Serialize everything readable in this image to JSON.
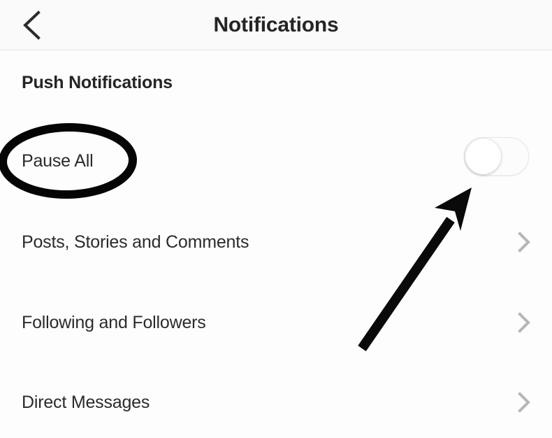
{
  "header": {
    "title": "Notifications",
    "back_icon": "chevron-left-icon"
  },
  "section": {
    "title": "Push Notifications"
  },
  "rows": [
    {
      "label": "Pause All",
      "control": "toggle",
      "toggle_state": "off"
    },
    {
      "label": "Posts, Stories and Comments",
      "control": "chevron-right-icon"
    },
    {
      "label": "Following and Followers",
      "control": "chevron-right-icon"
    },
    {
      "label": "Direct Messages",
      "control": "chevron-right-icon"
    }
  ],
  "annotations": {
    "ellipse": {
      "target": "Pause All",
      "color": "#050505"
    },
    "arrow": {
      "target": "Pause All toggle",
      "color": "#0a0a0a"
    }
  },
  "colors": {
    "background": "#fdfdfd",
    "header_background": "#fafafa",
    "text_primary": "#252525",
    "text_row": "#2b2b2b",
    "chevron": "#b6b6b6",
    "divider": "#e2e2e2",
    "annotation": "#050505"
  }
}
